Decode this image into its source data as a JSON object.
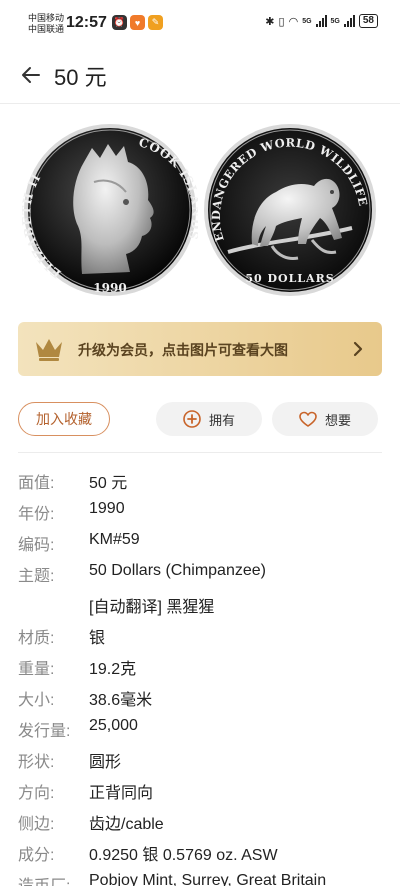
{
  "status_bar": {
    "carrier1": "中国移动",
    "carrier2": "中国联通",
    "time": "12:57",
    "network1": "5G",
    "network2": "5G",
    "battery": "58"
  },
  "nav": {
    "title": "50 元"
  },
  "coin": {
    "obverse_legend_left": "ELIZABETH II",
    "obverse_legend_right": "COOK ISLANDS",
    "obverse_year": "1990",
    "reverse_legend": "ENDANGERED WORLD WILDLIFE",
    "reverse_denomination": "50 DOLLARS"
  },
  "banner": {
    "text": "升级为会员，点击图片可查看大图"
  },
  "actions": {
    "add_collection": "加入收藏",
    "own": "拥有",
    "want": "想要"
  },
  "details": [
    {
      "key": "面值:",
      "value": "50 元"
    },
    {
      "key": "年份:",
      "value": "1990"
    },
    {
      "key": "编码:",
      "value": "KM#59"
    },
    {
      "key": "主题:",
      "value": "50 Dollars (Chimpanzee)"
    },
    {
      "key": "",
      "value": "[自动翻译] 黑猩猩"
    },
    {
      "key": "材质:",
      "value": "银"
    },
    {
      "key": "重量:",
      "value": "19.2克"
    },
    {
      "key": "大小:",
      "value": "38.6毫米"
    },
    {
      "key": "发行量:",
      "value": "25,000"
    },
    {
      "key": "形状:",
      "value": "圆形"
    },
    {
      "key": "方向:",
      "value": "正背同向"
    },
    {
      "key": "侧边:",
      "value": "齿边/cable"
    },
    {
      "key": "成分:",
      "value": "0.9250 银 0.5769 oz. ASW"
    },
    {
      "key": "造币厂:",
      "value": "Pobjoy Mint, Surrey, Great Britain"
    }
  ]
}
